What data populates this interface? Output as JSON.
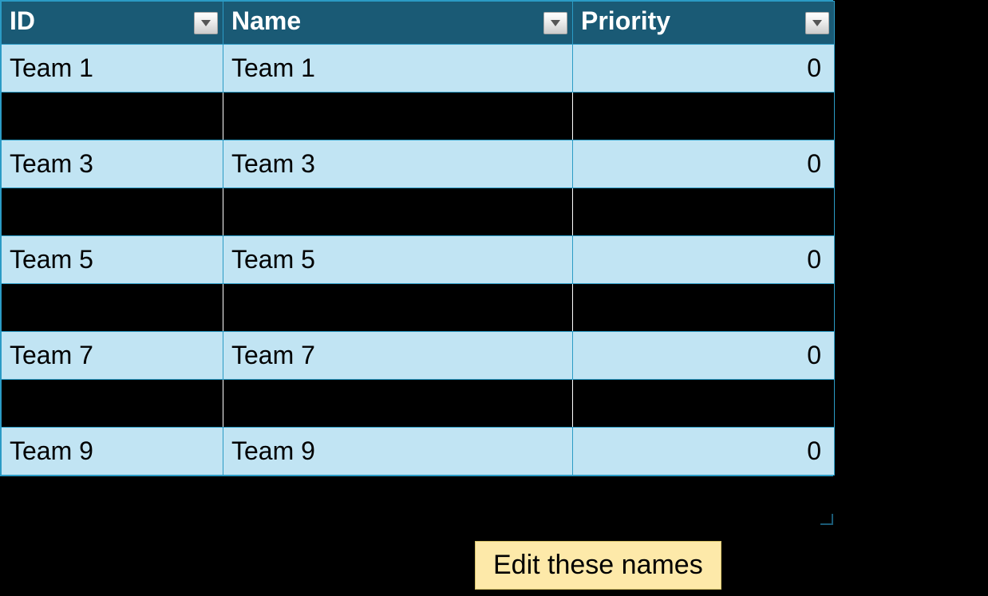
{
  "table": {
    "headers": {
      "id": "ID",
      "name": "Name",
      "priority": "Priority"
    },
    "rows": [
      {
        "id": "Team 1",
        "name": "Team 1",
        "priority": "0",
        "style": "light"
      },
      {
        "id": "",
        "name": "",
        "priority": "",
        "style": "dark"
      },
      {
        "id": "Team 3",
        "name": "Team 3",
        "priority": "0",
        "style": "light"
      },
      {
        "id": "",
        "name": "",
        "priority": "",
        "style": "dark"
      },
      {
        "id": "Team 5",
        "name": "Team 5",
        "priority": "0",
        "style": "light"
      },
      {
        "id": "",
        "name": "",
        "priority": "",
        "style": "dark"
      },
      {
        "id": "Team 7",
        "name": "Team 7",
        "priority": "0",
        "style": "light"
      },
      {
        "id": "",
        "name": "",
        "priority": "",
        "style": "dark"
      },
      {
        "id": "Team 9",
        "name": "Team 9",
        "priority": "0",
        "style": "light"
      }
    ]
  },
  "callout": {
    "text": "Edit these names"
  }
}
